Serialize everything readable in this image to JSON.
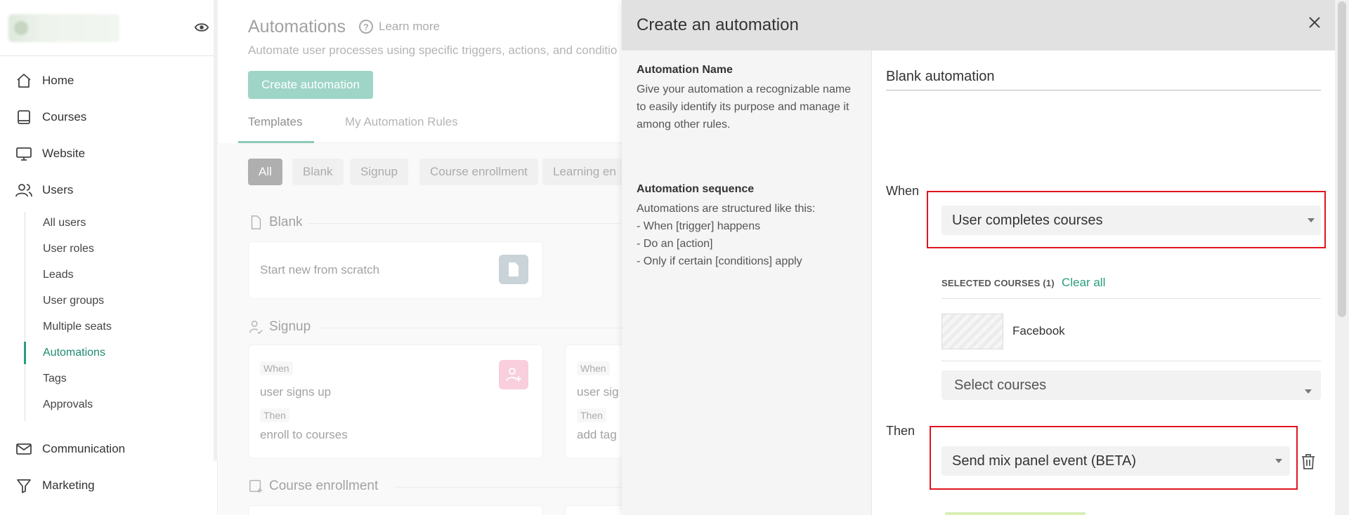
{
  "sidebar": {
    "nav": [
      {
        "label": "Home",
        "icon": "home-icon"
      },
      {
        "label": "Courses",
        "icon": "book-icon"
      },
      {
        "label": "Website",
        "icon": "monitor-icon"
      },
      {
        "label": "Users",
        "icon": "users-icon"
      },
      {
        "label": "Communication",
        "icon": "mail-icon"
      },
      {
        "label": "Marketing",
        "icon": "funnel-icon"
      }
    ],
    "users_sub": [
      "All users",
      "User roles",
      "Leads",
      "User groups",
      "Multiple seats",
      "Automations",
      "Tags",
      "Approvals"
    ],
    "active_sub": "Automations"
  },
  "main": {
    "title": "Automations",
    "learn_more": "Learn more",
    "subtitle": "Automate user processes using specific triggers, actions, and conditio",
    "create_button": "Create automation",
    "tabs": [
      "Templates",
      "My Automation Rules"
    ],
    "chips": [
      "All",
      "Blank",
      "Signup",
      "Course enrollment",
      "Learning en"
    ],
    "sections": {
      "blank": {
        "title": "Blank",
        "card_text": "Start new from scratch"
      },
      "signup": {
        "title": "Signup",
        "card1": {
          "when_tag": "When",
          "when": "user signs up",
          "then_tag": "Then",
          "then": "enroll to courses"
        },
        "card2": {
          "when_tag": "When",
          "when": "user sig",
          "then_tag": "Then",
          "then": "add tag"
        }
      },
      "course_enrollment": {
        "title": "Course enrollment"
      }
    }
  },
  "drawer": {
    "title": "Create an automation",
    "automation_name": {
      "title": "Automation Name",
      "description": "Give your automation a recognizable name to easily identify its purpose and manage it among other rules.",
      "value": "Blank automation"
    },
    "sequence": {
      "title": "Automation sequence",
      "lines": [
        "Automations are structured like this:",
        "- When [trigger] happens",
        "- Do an [action]",
        "- Only if certain [conditions] apply"
      ]
    },
    "when_label": "When",
    "trigger_value": "User completes courses",
    "selected_courses_label": "SELECTED COURSES (1)",
    "clear_all": "Clear all",
    "course_name": "Facebook",
    "select_courses_placeholder": "Select courses",
    "then_label": "Then",
    "action_value": "Send mix panel event (BETA)"
  },
  "colors": {
    "accent": "#2a9d7e",
    "highlight": "#e0141e"
  }
}
